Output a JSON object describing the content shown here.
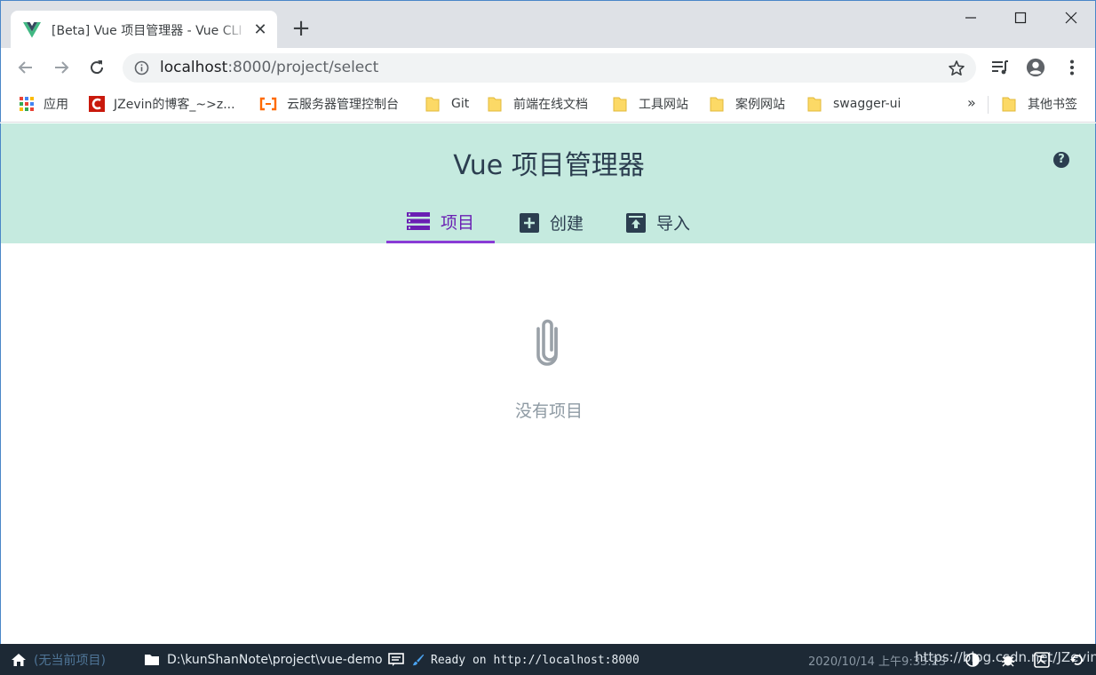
{
  "browser": {
    "tab_title": "[Beta] Vue 项目管理器 - Vue CLI",
    "url_host": "localhost",
    "url_rest": ":8000/project/select"
  },
  "bookmarks": {
    "items": [
      "应用",
      "JZevin的博客_~>z...",
      "云服务器管理控制台",
      "Git",
      "前端在线文档",
      "工具网站",
      "案例网站",
      "swagger-ui"
    ],
    "more": "»",
    "other": "其他书签"
  },
  "app": {
    "title": "Vue 项目管理器",
    "help": "?",
    "tabs": [
      "项目",
      "创建",
      "导入"
    ],
    "empty_text": "没有项目"
  },
  "statusbar": {
    "current_project": "(无当前项目)",
    "path": "D:\\kunShanNote\\project\\vue-demo",
    "log": "Ready on http://localhost:8000",
    "datetime": "2020/10/14 上午9:33:23",
    "watermark": "https://blog.csdn.net/JZevin"
  },
  "colors": {
    "header_bg": "#c5eadf",
    "accent": "#6a1fb3",
    "statusbar_bg": "#1d2935",
    "vue_green": "#41b883"
  }
}
